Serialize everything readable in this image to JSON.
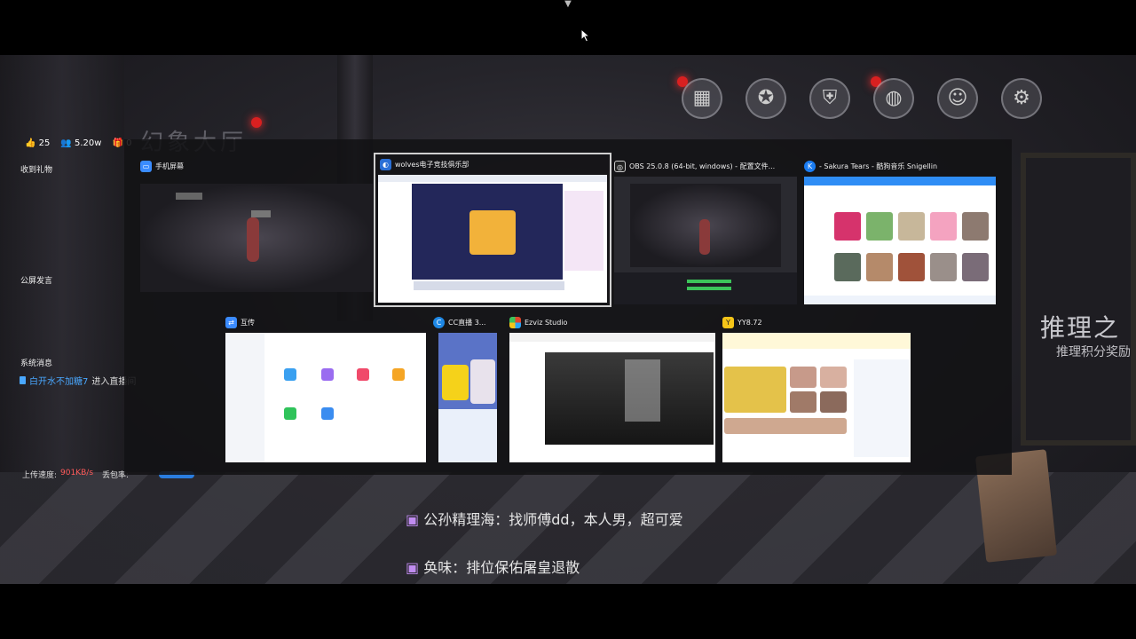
{
  "stream_overlay": {
    "likes": "25",
    "viewers": "5.20w",
    "gifts": "0",
    "gift_section": "收到礼物",
    "public_chat_section": "公屏发言",
    "system_section": "系统消息",
    "system_user": "白开水不加糖7",
    "system_action": "进入直播间",
    "upload_label": "上传速度:",
    "upload_value": "901KB/s",
    "packet_label": "丢包率:"
  },
  "game_scene": {
    "hall_title": "幻象大厅",
    "side_title": "推理之",
    "side_subtitle": "推理积分奖励",
    "danmaku": [
      {
        "user": "公孙精理海",
        "text": "找师傅dd，本人男，超可爱"
      },
      {
        "user": "奂味",
        "text": "排位保佑屠皇退散"
      }
    ]
  },
  "task_switcher": {
    "windows": [
      {
        "title": "手机屏幕",
        "icon": "phone-screen-icon",
        "icon_color": "#3a8cff"
      },
      {
        "title": "wolves电子竞技俱乐部",
        "icon": "browser-icon",
        "icon_color": "#2a6fd6",
        "active": true
      },
      {
        "title": "OBS 25.0.8 (64-bit, windows) - 配置文件...",
        "icon": "obs-icon",
        "icon_color": "#222222"
      },
      {
        "title": "- Sakura Tears - 酷狗音乐 Snigellin",
        "icon": "kugou-icon",
        "icon_color": "#1a7cf2"
      },
      {
        "title": "互传",
        "icon": "transfer-icon",
        "icon_color": "#3b8bff"
      },
      {
        "title": "CC直播 3...",
        "icon": "cc-live-icon",
        "icon_color": "#1e88e5"
      },
      {
        "title": "Ezviz Studio",
        "icon": "ezviz-icon",
        "icon_color": "#e0452b"
      },
      {
        "title": "YY8.72",
        "icon": "yy-icon",
        "icon_color": "#f5c518"
      }
    ]
  },
  "colors": {
    "accent_blue": "#4aa8ff",
    "alert_red": "#ff5a5a"
  }
}
